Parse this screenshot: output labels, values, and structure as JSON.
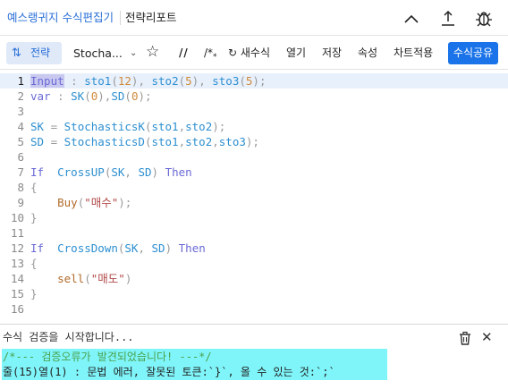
{
  "titlebar": {
    "tab_editor": "예스랭귀지 수식편집기",
    "tab_report": "전략리포트"
  },
  "toolbar": {
    "strategy": "전략",
    "select_value": "Stocha...",
    "comment": "//",
    "block_comment": "/*",
    "new_formula": "새수식",
    "open": "열기",
    "save": "저장",
    "properties": "속성",
    "apply_chart": "차트적용",
    "share": "수식공유"
  },
  "editor": {
    "lines": [
      {
        "n": "1",
        "tokens": [
          [
            "kw-sel",
            "Input"
          ],
          [
            "br",
            " : "
          ],
          [
            "fn",
            "sto1"
          ],
          [
            "br",
            "("
          ],
          [
            "num",
            "12"
          ],
          [
            "br",
            "), "
          ],
          [
            "fn",
            "sto2"
          ],
          [
            "br",
            "("
          ],
          [
            "num",
            "5"
          ],
          [
            "br",
            "), "
          ],
          [
            "fn",
            "sto3"
          ],
          [
            "br",
            "("
          ],
          [
            "num",
            "5"
          ],
          [
            "br",
            ");"
          ]
        ]
      },
      {
        "n": "2",
        "tokens": [
          [
            "kw",
            "var"
          ],
          [
            "br",
            " : "
          ],
          [
            "fn",
            "SK"
          ],
          [
            "br",
            "("
          ],
          [
            "num",
            "0"
          ],
          [
            "br",
            "),"
          ],
          [
            "fn",
            "SD"
          ],
          [
            "br",
            "("
          ],
          [
            "num",
            "0"
          ],
          [
            "br",
            ");"
          ]
        ]
      },
      {
        "n": "3",
        "tokens": []
      },
      {
        "n": "4",
        "tokens": [
          [
            "fn",
            "SK"
          ],
          [
            "br",
            " = "
          ],
          [
            "fn",
            "StochasticsK"
          ],
          [
            "br",
            "("
          ],
          [
            "fn",
            "sto1"
          ],
          [
            "br",
            ","
          ],
          [
            "fn",
            "sto2"
          ],
          [
            "br",
            ");"
          ]
        ]
      },
      {
        "n": "5",
        "tokens": [
          [
            "fn",
            "SD"
          ],
          [
            "br",
            " = "
          ],
          [
            "fn",
            "StochasticsD"
          ],
          [
            "br",
            "("
          ],
          [
            "fn",
            "sto1"
          ],
          [
            "br",
            ","
          ],
          [
            "fn",
            "sto2"
          ],
          [
            "br",
            ","
          ],
          [
            "fn",
            "sto3"
          ],
          [
            "br",
            ");"
          ]
        ]
      },
      {
        "n": "6",
        "tokens": []
      },
      {
        "n": "7",
        "tokens": [
          [
            "kw",
            "If"
          ],
          [
            "pl",
            "  "
          ],
          [
            "fn",
            "CrossUP"
          ],
          [
            "br",
            "("
          ],
          [
            "fn",
            "SK"
          ],
          [
            "br",
            ", "
          ],
          [
            "fn",
            "SD"
          ],
          [
            "br",
            ") "
          ],
          [
            "kw",
            "Then"
          ]
        ]
      },
      {
        "n": "8",
        "tokens": [
          [
            "br",
            "{"
          ]
        ]
      },
      {
        "n": "9",
        "tokens": [
          [
            "pl",
            "    "
          ],
          [
            "fn-call",
            "Buy"
          ],
          [
            "br",
            "("
          ],
          [
            "str",
            "\"매수\""
          ],
          [
            "br",
            ");"
          ]
        ]
      },
      {
        "n": "10",
        "tokens": [
          [
            "br",
            "}"
          ]
        ]
      },
      {
        "n": "11",
        "tokens": []
      },
      {
        "n": "12",
        "tokens": [
          [
            "kw",
            "If"
          ],
          [
            "pl",
            "  "
          ],
          [
            "fn",
            "CrossDown"
          ],
          [
            "br",
            "("
          ],
          [
            "fn",
            "SK"
          ],
          [
            "br",
            ", "
          ],
          [
            "fn",
            "SD"
          ],
          [
            "br",
            ") "
          ],
          [
            "kw",
            "Then"
          ]
        ]
      },
      {
        "n": "13",
        "tokens": [
          [
            "br",
            "{"
          ]
        ]
      },
      {
        "n": "14",
        "tokens": [
          [
            "pl",
            "    "
          ],
          [
            "fn-call",
            "sell"
          ],
          [
            "br",
            "("
          ],
          [
            "str",
            "\"매도\""
          ],
          [
            "br",
            ")"
          ]
        ]
      },
      {
        "n": "15",
        "tokens": [
          [
            "br",
            "}"
          ]
        ]
      },
      {
        "n": "16",
        "tokens": []
      }
    ]
  },
  "output": {
    "start": "수식 검증을 시작합니다...",
    "line1": "/*--- 검증오류가 발견되었습니다! ---*/",
    "line2": "줄(15)열(1) : 문법 에러, 잘못된 토큰:`}`, 올 수 있는 것:`;`"
  },
  "colors": {
    "accent": "#2a6fd8",
    "share_bg": "#1a73e8",
    "error_highlight": "#7ff5fa"
  }
}
